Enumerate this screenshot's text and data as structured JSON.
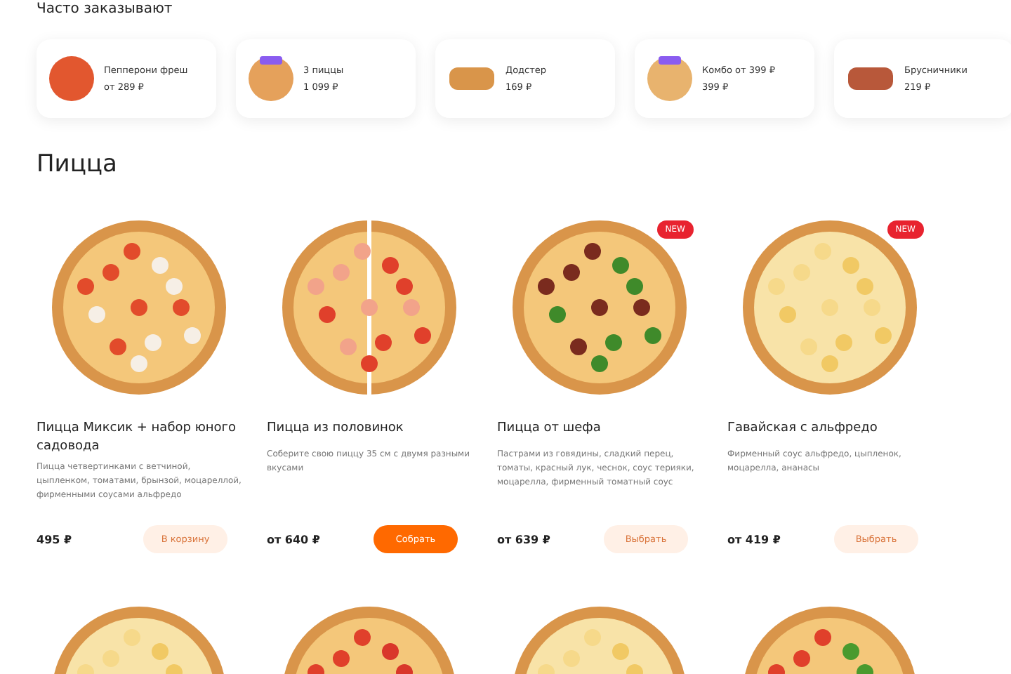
{
  "frequent": {
    "title": "Часто заказывают",
    "items": [
      {
        "name": "Пепперони фреш",
        "price": "от 289 ₽",
        "kind": "pizza"
      },
      {
        "name": "3 пиццы",
        "price": "1 099 ₽",
        "kind": "stack"
      },
      {
        "name": "Додстер",
        "price": "169 ₽",
        "kind": "roll"
      },
      {
        "name": "Комбо от 399 ₽",
        "price": "399 ₽",
        "kind": "combo"
      },
      {
        "name": "Брусничники",
        "price": "219 ₽",
        "kind": "dessert"
      }
    ]
  },
  "section": {
    "title": "Пицца",
    "products": [
      {
        "name": "Пицца Миксик + набор юного садовода",
        "description": "Пицца четвертинками с ветчиной, цыпленком, томатами, брынзой, моцареллой, фирменными соусами альфредо",
        "price": "495 ₽",
        "button": {
          "label": "В корзину",
          "kind": "soft"
        }
      },
      {
        "name": "Пицца из половинок",
        "description": "Соберите свою пиццу 35 см с двумя разными вкусами",
        "price": "от 640 ₽",
        "button": {
          "label": "Собрать",
          "kind": "filled"
        }
      },
      {
        "name": "Пицца от шефа",
        "description": "Пастрами из говядины, сладкий перец, томаты, красный лук, чеснок, соус терияки, моцарелла, фирменный томатный соус",
        "price": "от 639 ₽",
        "button": {
          "label": "Выбрать",
          "kind": "soft"
        },
        "badge": "NEW"
      },
      {
        "name": "Гавайская с альфредо",
        "description": "Фирменный соус альфредо, цыпленок, моцарелла, ананасы",
        "price": "от 419 ₽",
        "button": {
          "label": "Выбрать",
          "kind": "soft"
        },
        "badge": "NEW"
      }
    ]
  }
}
